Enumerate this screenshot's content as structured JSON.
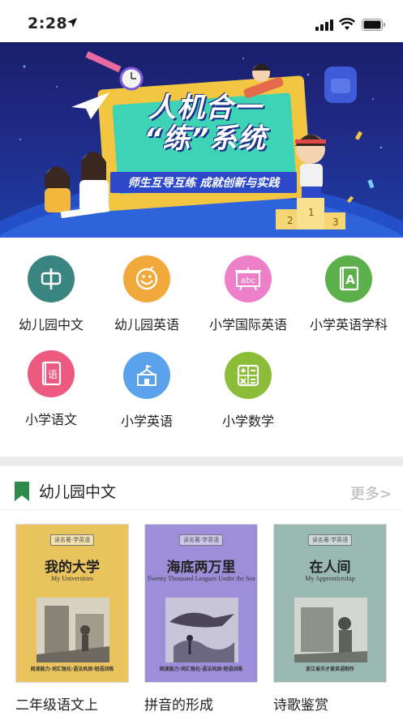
{
  "status_bar": {
    "time": "2:28"
  },
  "banner": {
    "title_line1": "人机合一",
    "title_line2": "“练”系统",
    "slogan": "师生互导互练  成就创新与实践"
  },
  "categories": [
    {
      "label": "幼儿园中文",
      "icon": "chinese-char-icon",
      "glyph": "中",
      "color": "#3a8580"
    },
    {
      "label": "幼儿园英语",
      "icon": "smiley-icon",
      "glyph": "☺",
      "color": "#f2a93b"
    },
    {
      "label": "小学国际英语",
      "icon": "abc-board-icon",
      "glyph": "abc",
      "color": "#ec7fc7"
    },
    {
      "label": "小学英语学科",
      "icon": "letter-a-book-icon",
      "glyph": "A",
      "color": "#5bb04b"
    },
    {
      "label": "小学语文",
      "icon": "chinese-book-icon",
      "glyph": "语",
      "color": "#ec5a7f"
    },
    {
      "label": "小学英语",
      "icon": "school-building-icon",
      "glyph": "⌂",
      "color": "#5aa3ec"
    },
    {
      "label": "小学数学",
      "icon": "calculator-icon",
      "glyph": "±",
      "color": "#8bbd38"
    }
  ],
  "section": {
    "title": "幼儿园中文",
    "more_label": "更多>",
    "accent": "#2c8a4a"
  },
  "books": [
    {
      "title": "二年级语文上",
      "cover_cn": "我的大学",
      "cover_en": "My Universities",
      "series": "读名著·学英语",
      "cover_color": "#e9c45e",
      "footer": "阅读能力·词汇强化·语法巩固·短语训练"
    },
    {
      "title": "拼音的形成",
      "cover_cn": "海底两万里",
      "cover_en": "Twenty Thousand Leagues Under the Sea",
      "series": "读名著·学英语",
      "cover_color": "#9d8ed9",
      "footer": "阅读能力·词汇强化·语法巩固·短语训练"
    },
    {
      "title": "诗歌鉴赏",
      "cover_cn": "在人间",
      "cover_en": "My Apprenticeship",
      "series": "读名著·学英语",
      "cover_color": "#9ab9b3",
      "footer": "浙江省天才爱英语制作"
    }
  ]
}
